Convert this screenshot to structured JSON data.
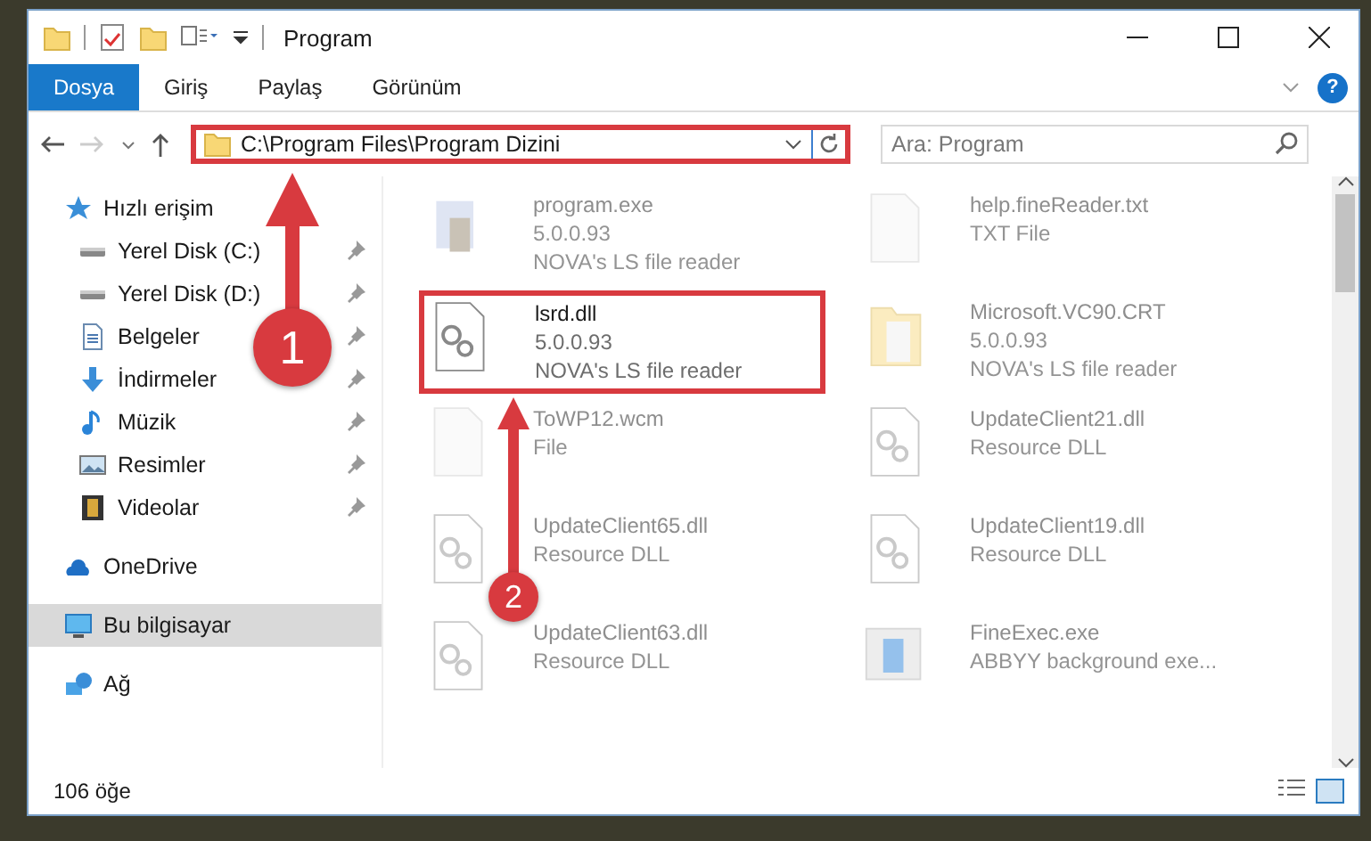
{
  "window": {
    "title": "Program"
  },
  "ribbon_tabs": [
    {
      "label": "Dosya",
      "selected": true
    },
    {
      "label": "Giriş",
      "selected": false
    },
    {
      "label": "Paylaş",
      "selected": false
    },
    {
      "label": "Görünüm",
      "selected": false
    }
  ],
  "help_button": "?",
  "address_bar": {
    "path": "C:\\Program Files\\Program Dizini",
    "highlighted": true
  },
  "search": {
    "placeholder": "Ara: Program"
  },
  "sidebar": {
    "items": [
      {
        "label": "Hızlı erişim",
        "selected": false,
        "children": [
          {
            "label": "Yerel Disk (C:)",
            "pinned": true,
            "selected": false
          },
          {
            "label": "Yerel Disk (D:)",
            "pinned": true,
            "selected": false
          },
          {
            "label": "Belgeler",
            "pinned": true,
            "selected": false
          },
          {
            "label": "İndirmeler",
            "pinned": true,
            "selected": false
          },
          {
            "label": "Müzik",
            "pinned": true,
            "selected": false
          },
          {
            "label": "Resimler",
            "pinned": true,
            "selected": false
          },
          {
            "label": "Videolar",
            "pinned": true,
            "selected": false
          }
        ]
      },
      {
        "label": "OneDrive",
        "selected": false
      },
      {
        "label": "Bu bilgisayar",
        "selected": true
      },
      {
        "label": "Ağ",
        "selected": false
      }
    ]
  },
  "files": [
    {
      "name": "program.exe",
      "details": [
        "5.0.0.93",
        "NOVA's LS file reader"
      ],
      "dimmed": true,
      "highlighted": false
    },
    {
      "name": "help.fineReader.txt",
      "details": [
        "TXT File"
      ],
      "dimmed": true,
      "highlighted": false
    },
    {
      "name": "lsrd.dll",
      "details": [
        "5.0.0.93",
        "NOVA's LS file reader"
      ],
      "dimmed": false,
      "highlighted": true
    },
    {
      "name": "Microsoft.VC90.CRT",
      "details": [
        "5.0.0.93",
        "NOVA's LS file reader"
      ],
      "dimmed": true,
      "highlighted": false
    },
    {
      "name": "ToWP12.wcm",
      "details": [
        "File"
      ],
      "dimmed": true,
      "highlighted": false
    },
    {
      "name": "UpdateClient21.dll",
      "details": [
        "Resource DLL"
      ],
      "dimmed": true,
      "highlighted": false
    },
    {
      "name": "UpdateClient65.dll",
      "details": [
        "Resource DLL"
      ],
      "dimmed": true,
      "highlighted": false
    },
    {
      "name": "UpdateClient19.dll",
      "details": [
        "Resource DLL"
      ],
      "dimmed": true,
      "highlighted": false
    },
    {
      "name": "UpdateClient63.dll",
      "details": [
        "Resource DLL"
      ],
      "dimmed": true,
      "highlighted": false
    },
    {
      "name": "FineExec.exe",
      "details": [
        "ABBYY background exe..."
      ],
      "dimmed": true,
      "highlighted": false
    }
  ],
  "callouts": [
    {
      "label": "1"
    },
    {
      "label": "2"
    }
  ],
  "status_bar": {
    "count": "106 öğe"
  }
}
